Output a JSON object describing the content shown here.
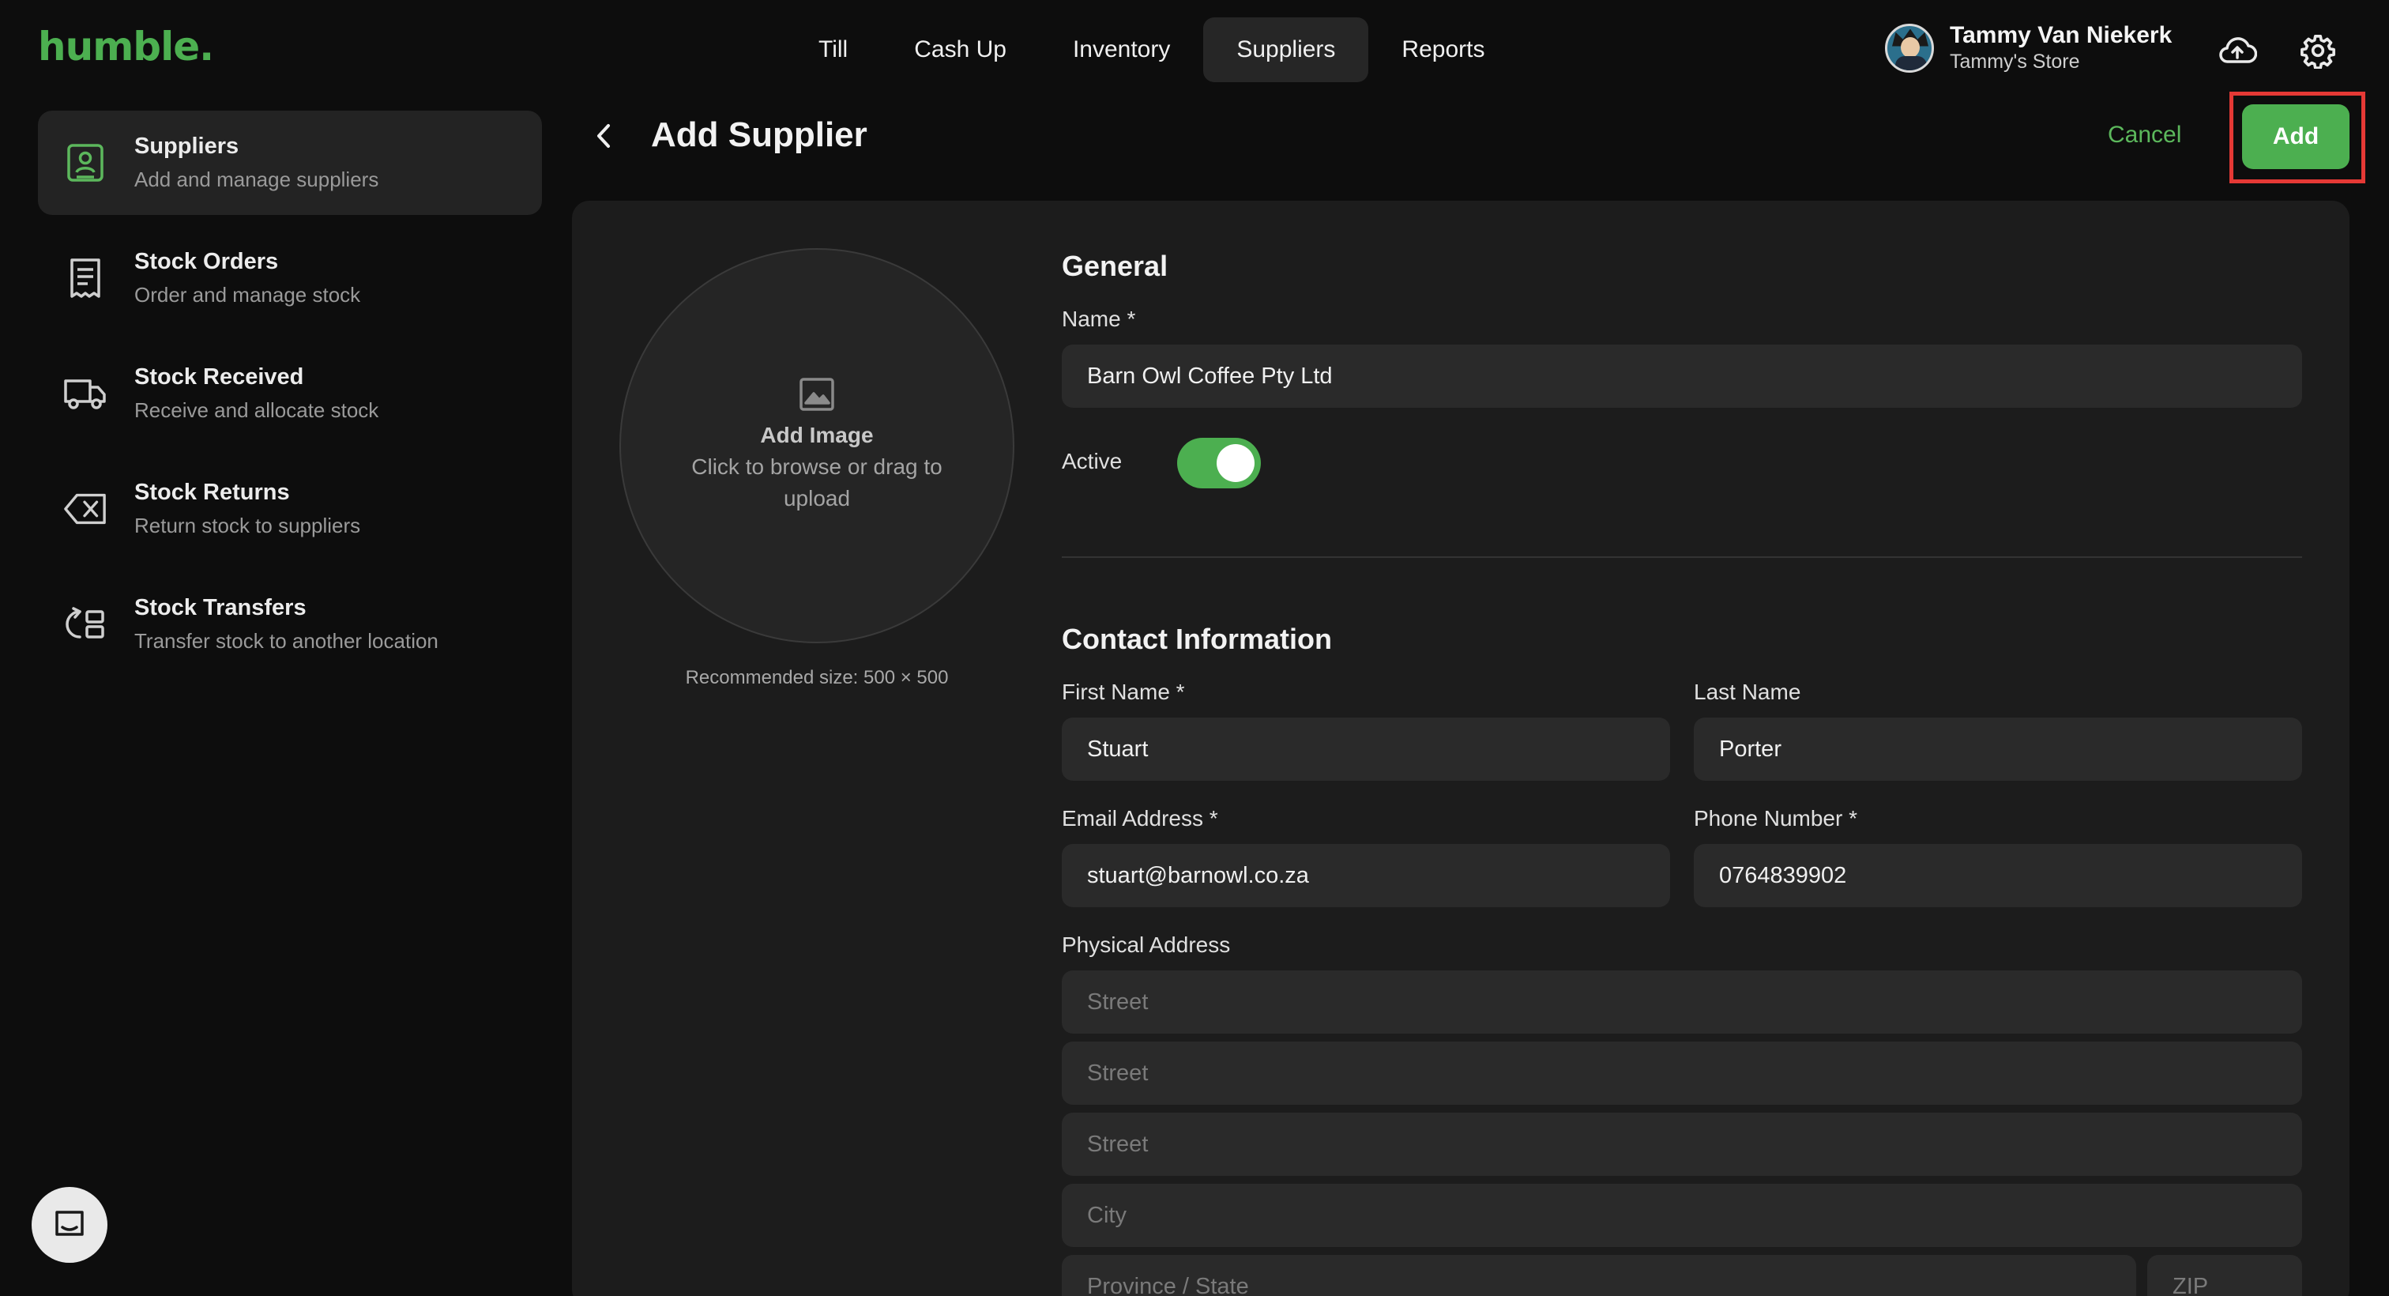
{
  "app": {
    "logo": "humble."
  },
  "nav": {
    "items": [
      {
        "label": "Till"
      },
      {
        "label": "Cash Up"
      },
      {
        "label": "Inventory"
      },
      {
        "label": "Suppliers",
        "active": true
      },
      {
        "label": "Reports"
      }
    ]
  },
  "user": {
    "name": "Tammy Van Niekerk",
    "store": "Tammy's Store"
  },
  "icons": {
    "cloud": "cloud-upload-icon",
    "settings": "gear-icon",
    "chat": "chat-icon"
  },
  "sidebar": {
    "items": [
      {
        "title": "Suppliers",
        "subtitle": "Add and manage suppliers",
        "icon": "supplier-icon",
        "active": true
      },
      {
        "title": "Stock Orders",
        "subtitle": "Order and manage stock",
        "icon": "receipt-icon"
      },
      {
        "title": "Stock Received",
        "subtitle": "Receive and allocate stock",
        "icon": "truck-icon"
      },
      {
        "title": "Stock Returns",
        "subtitle": "Return stock to suppliers",
        "icon": "return-icon"
      },
      {
        "title": "Stock Transfers",
        "subtitle": "Transfer stock to another location",
        "icon": "transfer-icon"
      }
    ]
  },
  "header": {
    "title": "Add Supplier",
    "cancel_label": "Cancel",
    "add_label": "Add"
  },
  "image_upload": {
    "title": "Add Image",
    "subtitle": "Click to browse or drag to upload",
    "recommended": "Recommended size: 500 × 500"
  },
  "general": {
    "title": "General",
    "name_label": "Name *",
    "name_value": "Barn Owl Coffee Pty Ltd",
    "active_label": "Active",
    "active": true
  },
  "contact": {
    "title": "Contact Information",
    "first_name_label": "First Name *",
    "first_name_value": "Stuart",
    "last_name_label": "Last Name",
    "last_name_value": "Porter",
    "email_label": "Email Address *",
    "email_value": "stuart@barnowl.co.za",
    "phone_label": "Phone Number *",
    "phone_value": "0764839902"
  },
  "address": {
    "label": "Physical Address",
    "street1_placeholder": "Street",
    "street2_placeholder": "Street",
    "street3_placeholder": "Street",
    "city_placeholder": "City",
    "province_placeholder": "Province / State",
    "zip_placeholder": "ZIP"
  },
  "colors": {
    "accent": "#4caf50",
    "highlight": "#e53935",
    "background": "#0d0d0d",
    "panel": "#1c1c1c"
  }
}
